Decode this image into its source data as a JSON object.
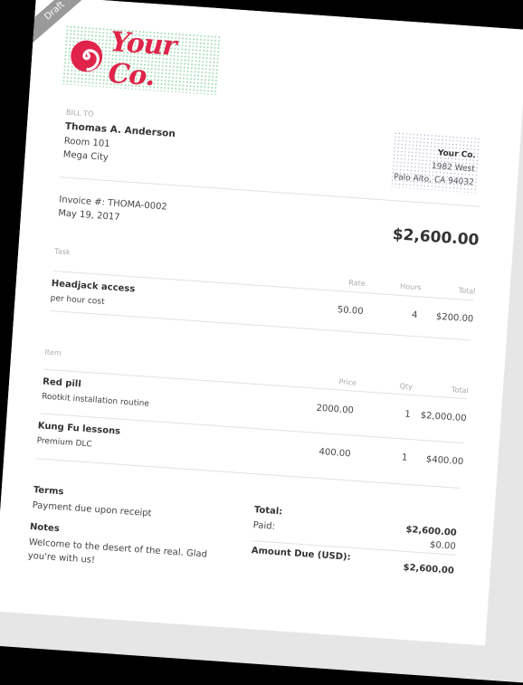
{
  "ribbon": "Draft",
  "logo": {
    "text": "Your Co.",
    "icon": "spiral-icon",
    "color": "#e0234a"
  },
  "bill_to": {
    "label": "BILL TO",
    "name": "Thomas A. Anderson",
    "line1": "Room 101",
    "line2": "Mega City"
  },
  "company": {
    "name": "Your Co.",
    "street": "1982 West",
    "city": "Palo Alto, CA 94032"
  },
  "invoice": {
    "number": "Invoice #: THOMA-0002",
    "date": "May 19, 2017",
    "total": "$2,600.00"
  },
  "tasks": {
    "section": "Task",
    "headers": [
      "Rate",
      "Hours",
      "Total"
    ],
    "rows": [
      {
        "name": "Headjack access",
        "desc": "per hour cost",
        "rate": "50.00",
        "qty": "4",
        "total": "$200.00"
      }
    ]
  },
  "items": {
    "section": "Item",
    "headers": [
      "Price",
      "Qty",
      "Total"
    ],
    "rows": [
      {
        "name": "Red pill",
        "desc": "Rootkit installation routine",
        "rate": "2000.00",
        "qty": "1",
        "total": "$2,000.00"
      },
      {
        "name": "Kung Fu lessons",
        "desc": "Premium DLC",
        "rate": "400.00",
        "qty": "1",
        "total": "$400.00"
      }
    ]
  },
  "terms": {
    "label": "Terms",
    "text": "Payment due upon receipt"
  },
  "notes": {
    "label": "Notes",
    "text": "Welcome to the desert of the real. Glad you're with us!"
  },
  "summary": {
    "total_label": "Total:",
    "total": "$2,600.00",
    "paid_label": "Paid:",
    "paid": "$0.00",
    "due_label": "Amount Due (USD):",
    "due": "$2,600.00"
  }
}
